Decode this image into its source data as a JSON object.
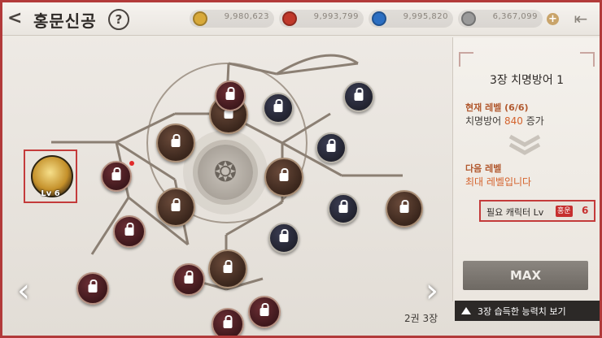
{
  "header": {
    "back_label": "<",
    "title": "홍문신공",
    "help_label": "?",
    "currencies": [
      {
        "icon": "gold-coin-icon",
        "color": "#d8a93a",
        "value": "9,980,623"
      },
      {
        "icon": "red-gem-icon",
        "color": "#c0392b",
        "value": "9,993,799"
      },
      {
        "icon": "blue-gem-icon",
        "color": "#2c6fc2",
        "value": "9,995,820"
      },
      {
        "icon": "silver-gem-icon",
        "color": "#9a9a9a",
        "value": "6,367,099"
      }
    ],
    "plus_label": "+",
    "exit_icon": "exit-icon"
  },
  "map": {
    "start_node_level": "Lv 6",
    "chapter_label": "2권 3장",
    "left_arrow": "‹",
    "right_arrow": "›"
  },
  "panel": {
    "title": "3장 치명방어 1",
    "current_level_label": "현재 레벨 (6/6)",
    "current_effect_prefix": "치명방어",
    "current_effect_value": "840",
    "current_effect_suffix": "증가",
    "next_level_label": "다음 레벨",
    "next_level_text": "최대 레벨입니다",
    "req_label": "필요 캐릭터 Lv",
    "req_badge": "홍운",
    "req_value": "6",
    "max_button": "MAX",
    "bottom_button": "3장 습득한 능력치 보기"
  }
}
